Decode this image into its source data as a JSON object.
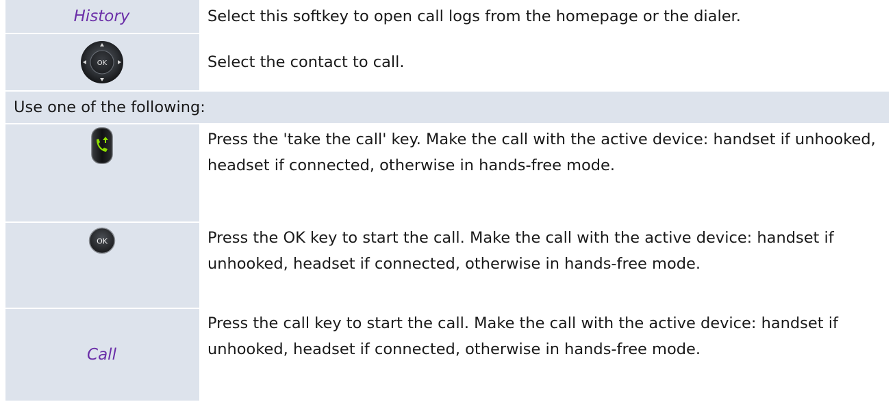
{
  "rows": [
    {
      "key_label": "History",
      "text": "Select this softkey to open call logs from the homepage or the dialer."
    },
    {
      "key_icon": "navigator-ok-icon",
      "text": "Select the contact to call."
    }
  ],
  "section_label": "Use one of the following:",
  "options": [
    {
      "key_icon": "take-the-call-key-icon",
      "text": "Press the 'take the call' key. Make the call with the active device: handset if unhooked, headset if connected, otherwise in hands-free mode."
    },
    {
      "key_icon": "ok-key-icon",
      "key_text": "OK",
      "text": "Press the OK key to start the call. Make the call with the active device: handset if unhooked, headset if connected, otherwise in hands-free mode."
    },
    {
      "key_label": "Call",
      "text": "Press the call key to start the call. Make the call with the active device: handset if unhooked, headset if connected, otherwise in hands-free mode."
    }
  ],
  "colors": {
    "cell_background": "#dde3ec",
    "softkey_label": "#6b2fa8",
    "call_key_green": "#7ed321"
  }
}
